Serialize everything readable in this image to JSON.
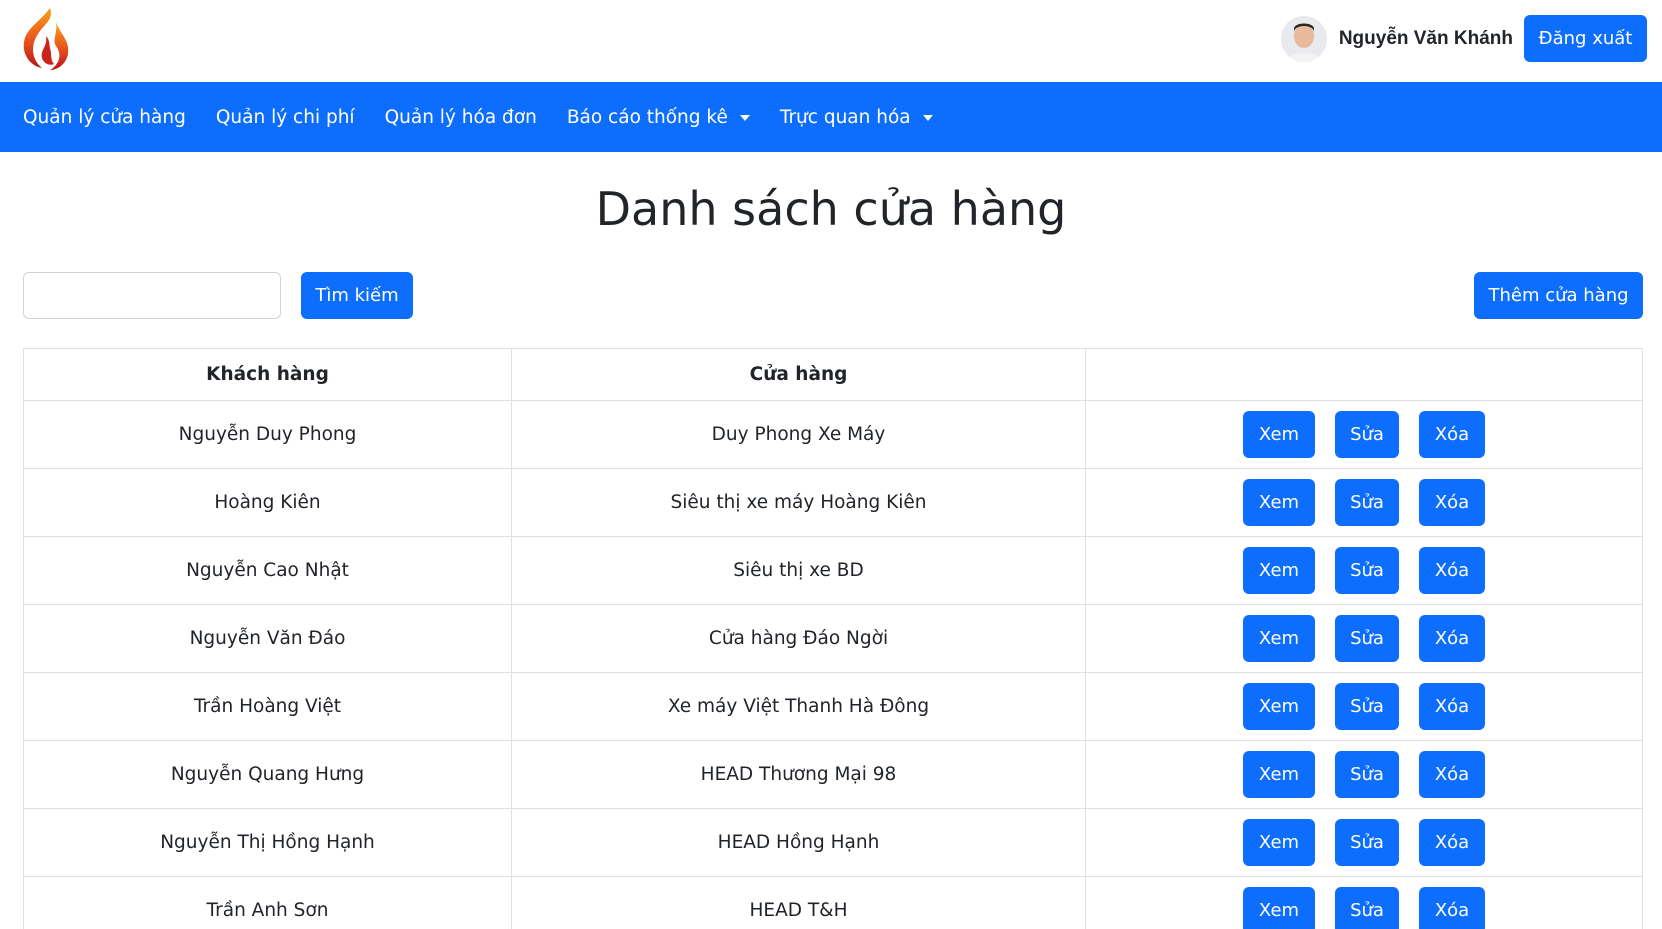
{
  "user": {
    "name": "Nguyễn Văn Khánh",
    "logout_label": "Đăng xuất"
  },
  "nav": {
    "items": [
      {
        "label": "Quản lý cửa hàng"
      },
      {
        "label": "Quản lý chi phí"
      },
      {
        "label": "Quản lý hóa đơn"
      },
      {
        "label": "Báo cáo thống kê"
      },
      {
        "label": "Trực quan hóa"
      }
    ]
  },
  "page": {
    "title": "Danh sách cửa hàng"
  },
  "search": {
    "value": "",
    "button_label": "Tìm kiếm"
  },
  "add_button_label": "Thêm cửa hàng",
  "table": {
    "headers": [
      "Khách hàng",
      "Cửa hàng",
      ""
    ],
    "actions": {
      "view": "Xem",
      "edit": "Sửa",
      "delete": "Xóa"
    },
    "rows": [
      {
        "customer": "Nguyễn Duy Phong",
        "store": "Duy Phong Xe Máy"
      },
      {
        "customer": "Hoàng Kiên",
        "store": "Siêu thị xe máy Hoàng Kiên"
      },
      {
        "customer": "Nguyễn Cao Nhật",
        "store": "Siêu thị xe BD"
      },
      {
        "customer": "Nguyễn Văn Đáo",
        "store": "Cửa hàng Đáo Ngời"
      },
      {
        "customer": "Trần Hoàng Việt",
        "store": "Xe máy Việt Thanh Hà Đông"
      },
      {
        "customer": "Nguyễn Quang Hưng",
        "store": "HEAD Thương Mại 98"
      },
      {
        "customer": "Nguyễn Thị Hồng Hạnh",
        "store": "HEAD Hồng Hạnh"
      },
      {
        "customer": "Trần Anh Sơn",
        "store": "HEAD T&H"
      }
    ]
  },
  "colors": {
    "primary": "#0d6efd",
    "text": "#212529",
    "border": "#dee2e6"
  },
  "icons": {
    "logo": "flame-logo-icon",
    "avatar": "user-avatar-photo",
    "dropdown": "caret-down-icon"
  }
}
